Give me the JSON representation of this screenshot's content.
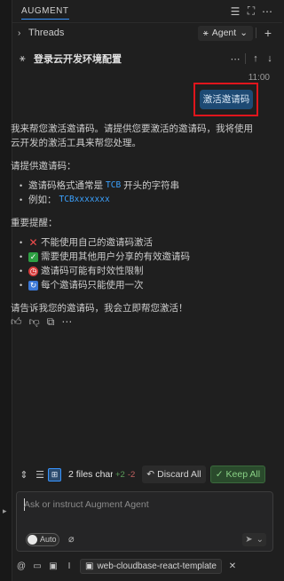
{
  "header": {
    "title": "AUGMENT"
  },
  "threads": {
    "label": "Threads",
    "mode_label": "Agent"
  },
  "conversation": {
    "title": "登录云开发环境配置",
    "timestamp": "11:00",
    "user_message": "激活邀请码",
    "reply": {
      "intro": "我来帮您激活邀请码。请提供您要激活的邀请码，我将使用云开发的激活工具来帮您处理。",
      "provide_heading": "请提供邀请码：",
      "format_prefix": "邀请码格式通常是",
      "format_code": "TCB",
      "format_suffix": "开头的字符串",
      "example_prefix": "例如：",
      "example_code": "TCBxxxxxxx",
      "notes_heading": "重要提醒：",
      "notes": [
        "不能使用自己的邀请码激活",
        "需要使用其他用户分享的有效邀请码",
        "邀请码可能有时效性限制",
        "每个邀请码只能使用一次"
      ],
      "closing": "请告诉我您的邀请码，我会立即帮您激活！"
    }
  },
  "diff_bar": {
    "files_label": "2 files char",
    "added": "+2",
    "removed": "-2",
    "discard_label": "Discard All",
    "keep_label": "Keep All"
  },
  "composer": {
    "placeholder": "Ask or instruct Augment Agent",
    "auto_label": "Auto",
    "context_chip": "web-cloudbase-react-template"
  },
  "colors": {
    "accent": "#3794ff",
    "user_bubble": "#1d4a74",
    "highlight_box": "#e0151c",
    "code": "#3ca2ff",
    "keep": "#89d185"
  }
}
